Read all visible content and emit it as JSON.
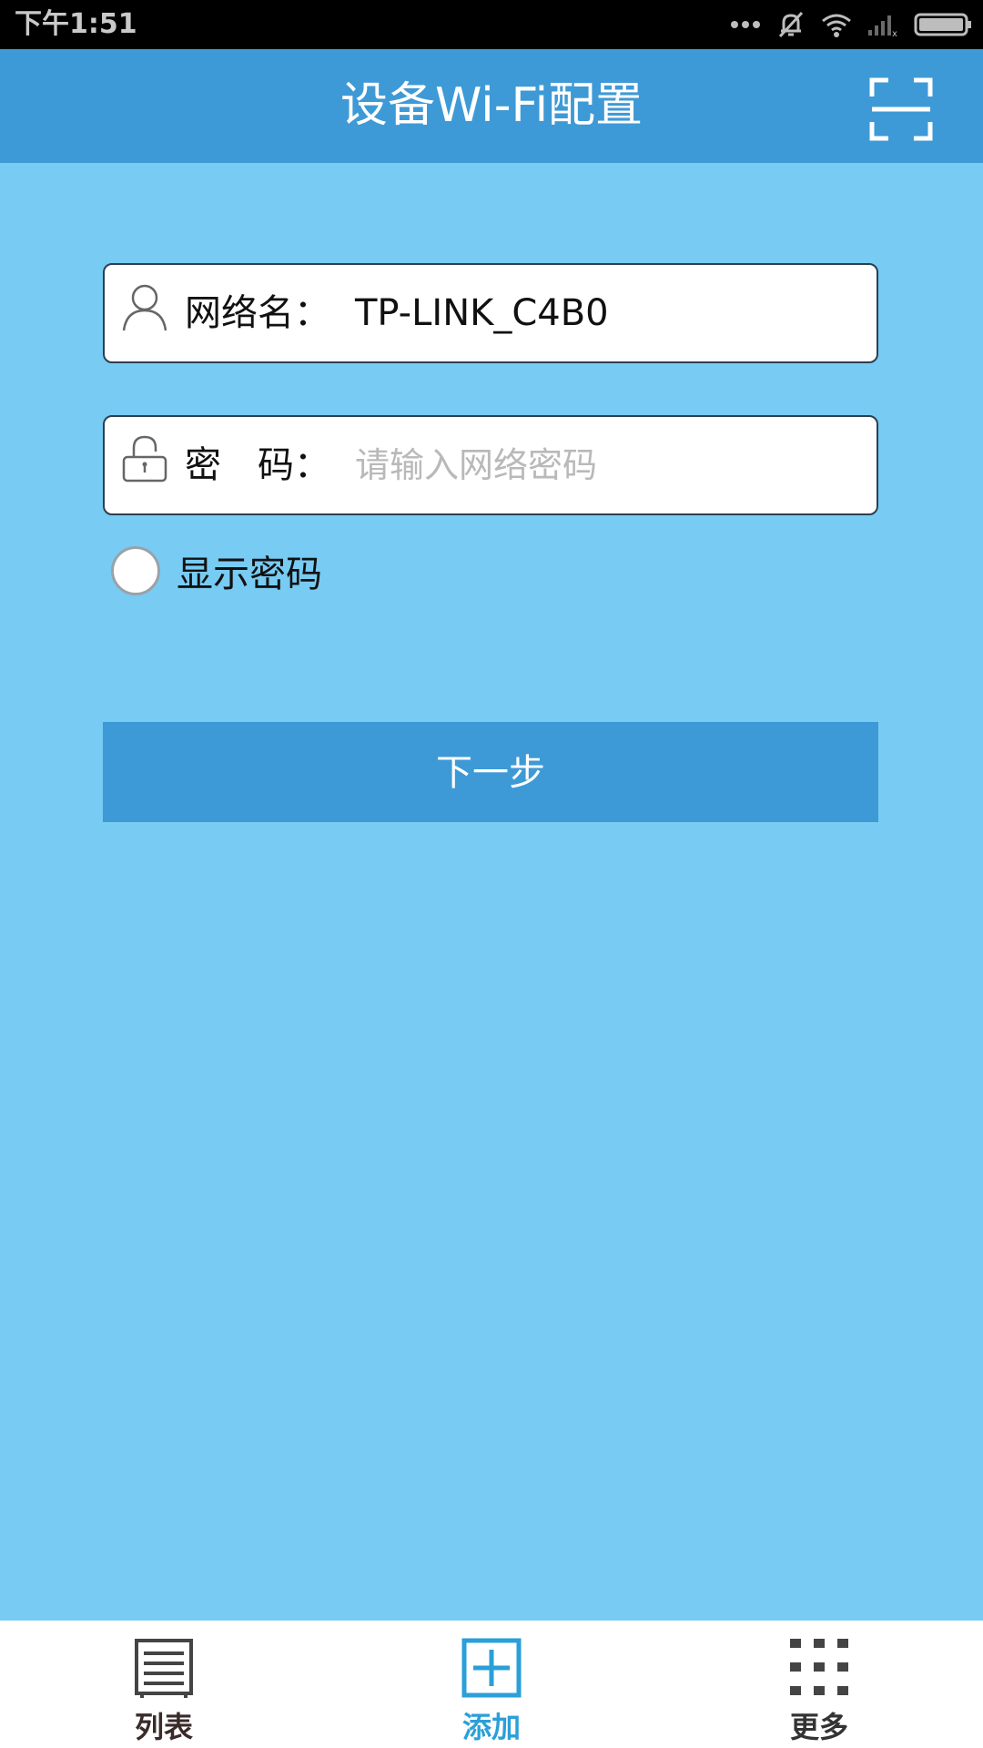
{
  "status_bar": {
    "time": "下午1:51",
    "icons": [
      "more-dots-icon",
      "mute-icon",
      "wifi-icon",
      "signal-icon",
      "battery-icon"
    ]
  },
  "header": {
    "title": "设备Wi-Fi配置",
    "scan_icon": "scan-icon"
  },
  "form": {
    "ssid": {
      "label": "网络名：",
      "value": "TP-LINK_C4B0",
      "icon": "user-icon"
    },
    "password": {
      "label": "密　码：",
      "value": "",
      "placeholder": "请输入网络密码",
      "icon": "lock-icon"
    },
    "show_password": {
      "label": "显示密码",
      "checked": false
    },
    "next_button": "下一步"
  },
  "bottom_nav": {
    "items": [
      {
        "label": "列表",
        "icon": "list-icon"
      },
      {
        "label": "添加",
        "icon": "add-icon",
        "active": true
      },
      {
        "label": "更多",
        "icon": "grid-icon"
      }
    ]
  },
  "colors": {
    "background": "#78cbf2",
    "primary": "#3e9ad6",
    "active_nav": "#2a9fd8"
  }
}
